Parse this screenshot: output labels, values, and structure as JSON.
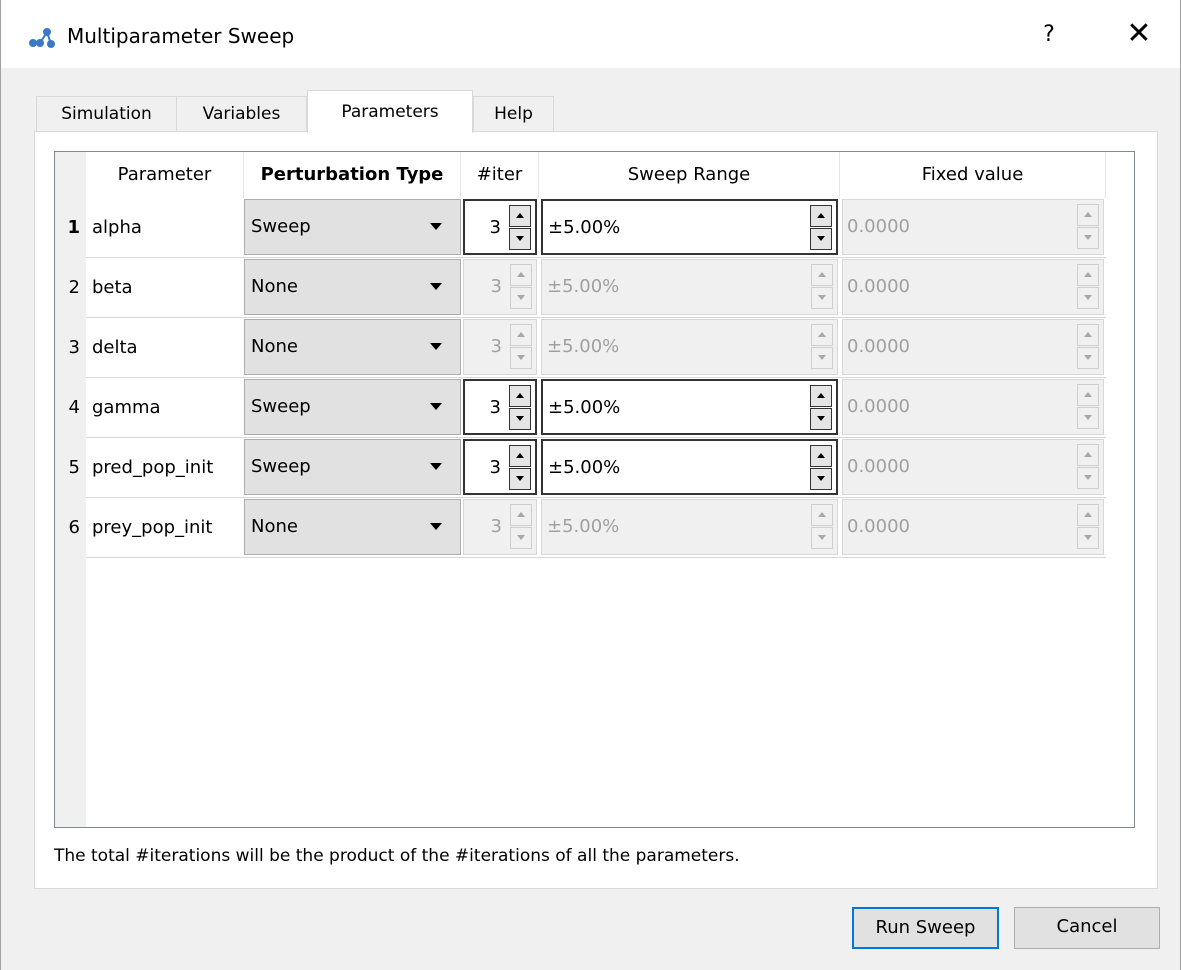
{
  "window": {
    "title": "Multiparameter Sweep",
    "help_label": "?",
    "close_label": "✕"
  },
  "tabs": [
    {
      "label": "Simulation",
      "active": false
    },
    {
      "label": "Variables",
      "active": false
    },
    {
      "label": "Parameters",
      "active": true
    },
    {
      "label": "Help",
      "active": false
    }
  ],
  "table": {
    "headers": [
      "Parameter",
      "Perturbation Type",
      "#iter",
      "Sweep Range",
      "Fixed value"
    ],
    "rows": [
      {
        "num": "1",
        "name": "alpha",
        "type": "Sweep",
        "iter": "3",
        "range": "±5.00%",
        "fixed": "0.0000",
        "enabled": true,
        "current": true
      },
      {
        "num": "2",
        "name": "beta",
        "type": "None",
        "iter": "3",
        "range": "±5.00%",
        "fixed": "0.0000",
        "enabled": false,
        "current": false
      },
      {
        "num": "3",
        "name": "delta",
        "type": "None",
        "iter": "3",
        "range": "±5.00%",
        "fixed": "0.0000",
        "enabled": false,
        "current": false
      },
      {
        "num": "4",
        "name": "gamma",
        "type": "Sweep",
        "iter": "3",
        "range": "±5.00%",
        "fixed": "0.0000",
        "enabled": true,
        "current": false
      },
      {
        "num": "5",
        "name": "pred_pop_init",
        "type": "Sweep",
        "iter": "3",
        "range": "±5.00%",
        "fixed": "0.0000",
        "enabled": true,
        "current": false
      },
      {
        "num": "6",
        "name": "prey_pop_init",
        "type": "None",
        "iter": "3",
        "range": "±5.00%",
        "fixed": "0.0000",
        "enabled": false,
        "current": false
      }
    ]
  },
  "note": "The total #iterations will be the product of the #iterations of all the parameters.",
  "buttons": {
    "run": "Run Sweep",
    "cancel": "Cancel"
  }
}
